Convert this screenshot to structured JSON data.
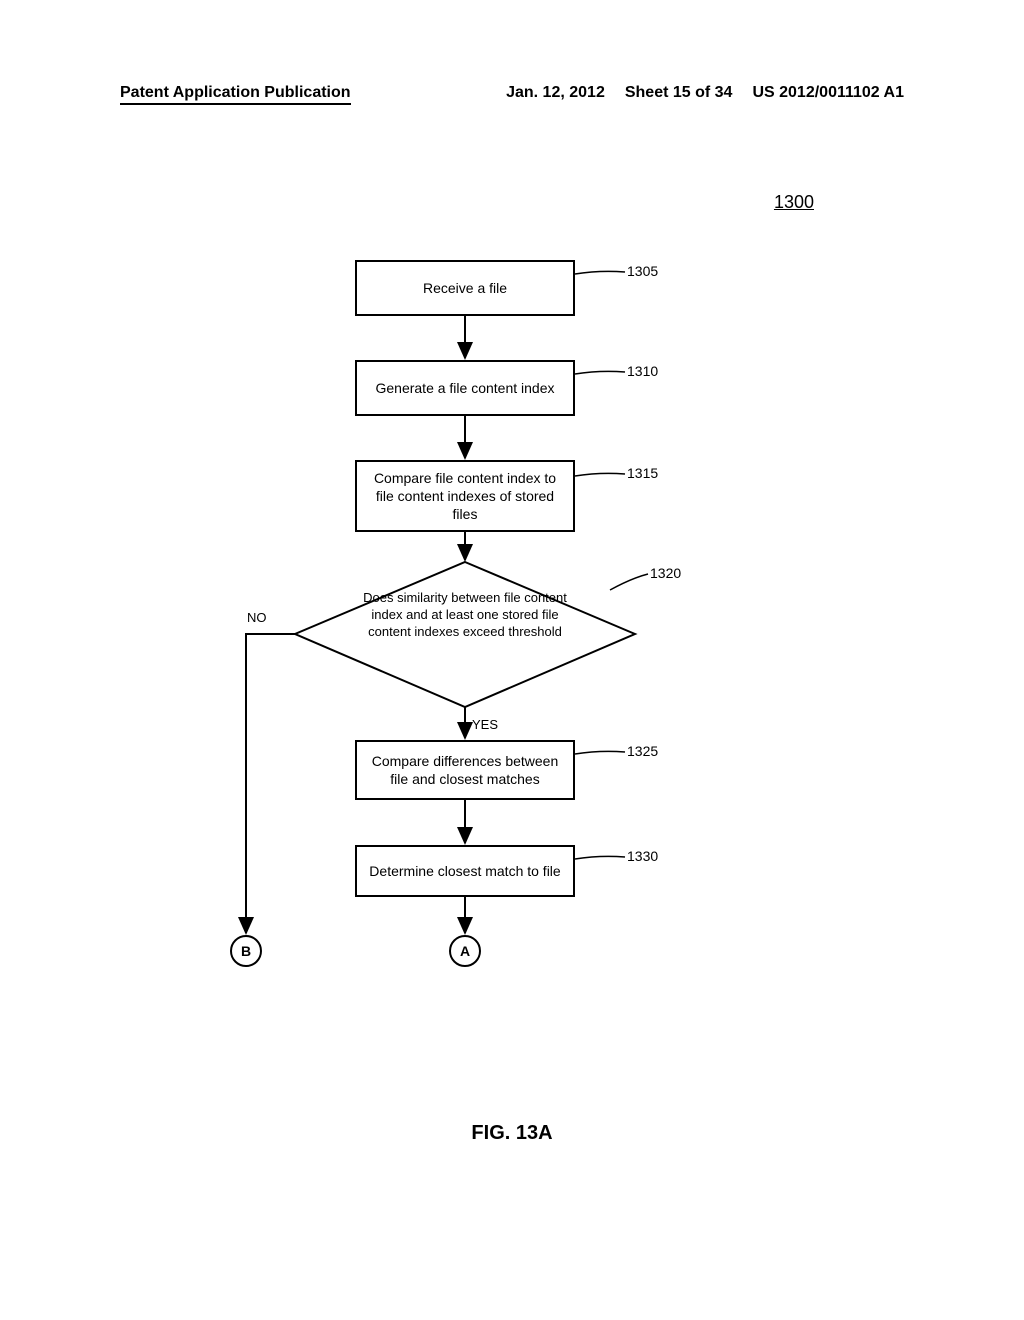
{
  "header": {
    "left": "Patent Application Publication",
    "date": "Jan. 12, 2012",
    "sheet": "Sheet 15 of 34",
    "pubnum": "US 2012/0011102 A1"
  },
  "figure_number": "1300",
  "figure_caption": "FIG. 13A",
  "steps": {
    "s1305": {
      "text": "Receive a file",
      "ref": "1305"
    },
    "s1310": {
      "text": "Generate a file content index",
      "ref": "1310"
    },
    "s1315": {
      "text": "Compare file content index to file content indexes of stored files",
      "ref": "1315"
    },
    "s1320": {
      "text": "Does similarity between file content index and at least one stored file content indexes exceed threshold",
      "ref": "1320"
    },
    "s1325": {
      "text": "Compare differences between file and closest matches",
      "ref": "1325"
    },
    "s1330": {
      "text": "Determine closest match to file",
      "ref": "1330"
    }
  },
  "edges": {
    "no": "NO",
    "yes": "YES"
  },
  "connectors": {
    "a": "A",
    "b": "B"
  },
  "chart_data": {
    "type": "flowchart",
    "title": "FIG. 13A",
    "figure_ref": "1300",
    "nodes": [
      {
        "id": "1305",
        "type": "process",
        "label": "Receive a file"
      },
      {
        "id": "1310",
        "type": "process",
        "label": "Generate a file content index"
      },
      {
        "id": "1315",
        "type": "process",
        "label": "Compare file content index to file content indexes of stored files"
      },
      {
        "id": "1320",
        "type": "decision",
        "label": "Does similarity between file content index and at least one stored file content indexes exceed threshold"
      },
      {
        "id": "1325",
        "type": "process",
        "label": "Compare differences between file and closest matches"
      },
      {
        "id": "1330",
        "type": "process",
        "label": "Determine closest match to file"
      },
      {
        "id": "A",
        "type": "connector",
        "label": "A"
      },
      {
        "id": "B",
        "type": "connector",
        "label": "B"
      }
    ],
    "edges": [
      {
        "from": "1305",
        "to": "1310"
      },
      {
        "from": "1310",
        "to": "1315"
      },
      {
        "from": "1315",
        "to": "1320"
      },
      {
        "from": "1320",
        "to": "1325",
        "label": "YES"
      },
      {
        "from": "1320",
        "to": "B",
        "label": "NO"
      },
      {
        "from": "1325",
        "to": "1330"
      },
      {
        "from": "1330",
        "to": "A"
      }
    ]
  }
}
